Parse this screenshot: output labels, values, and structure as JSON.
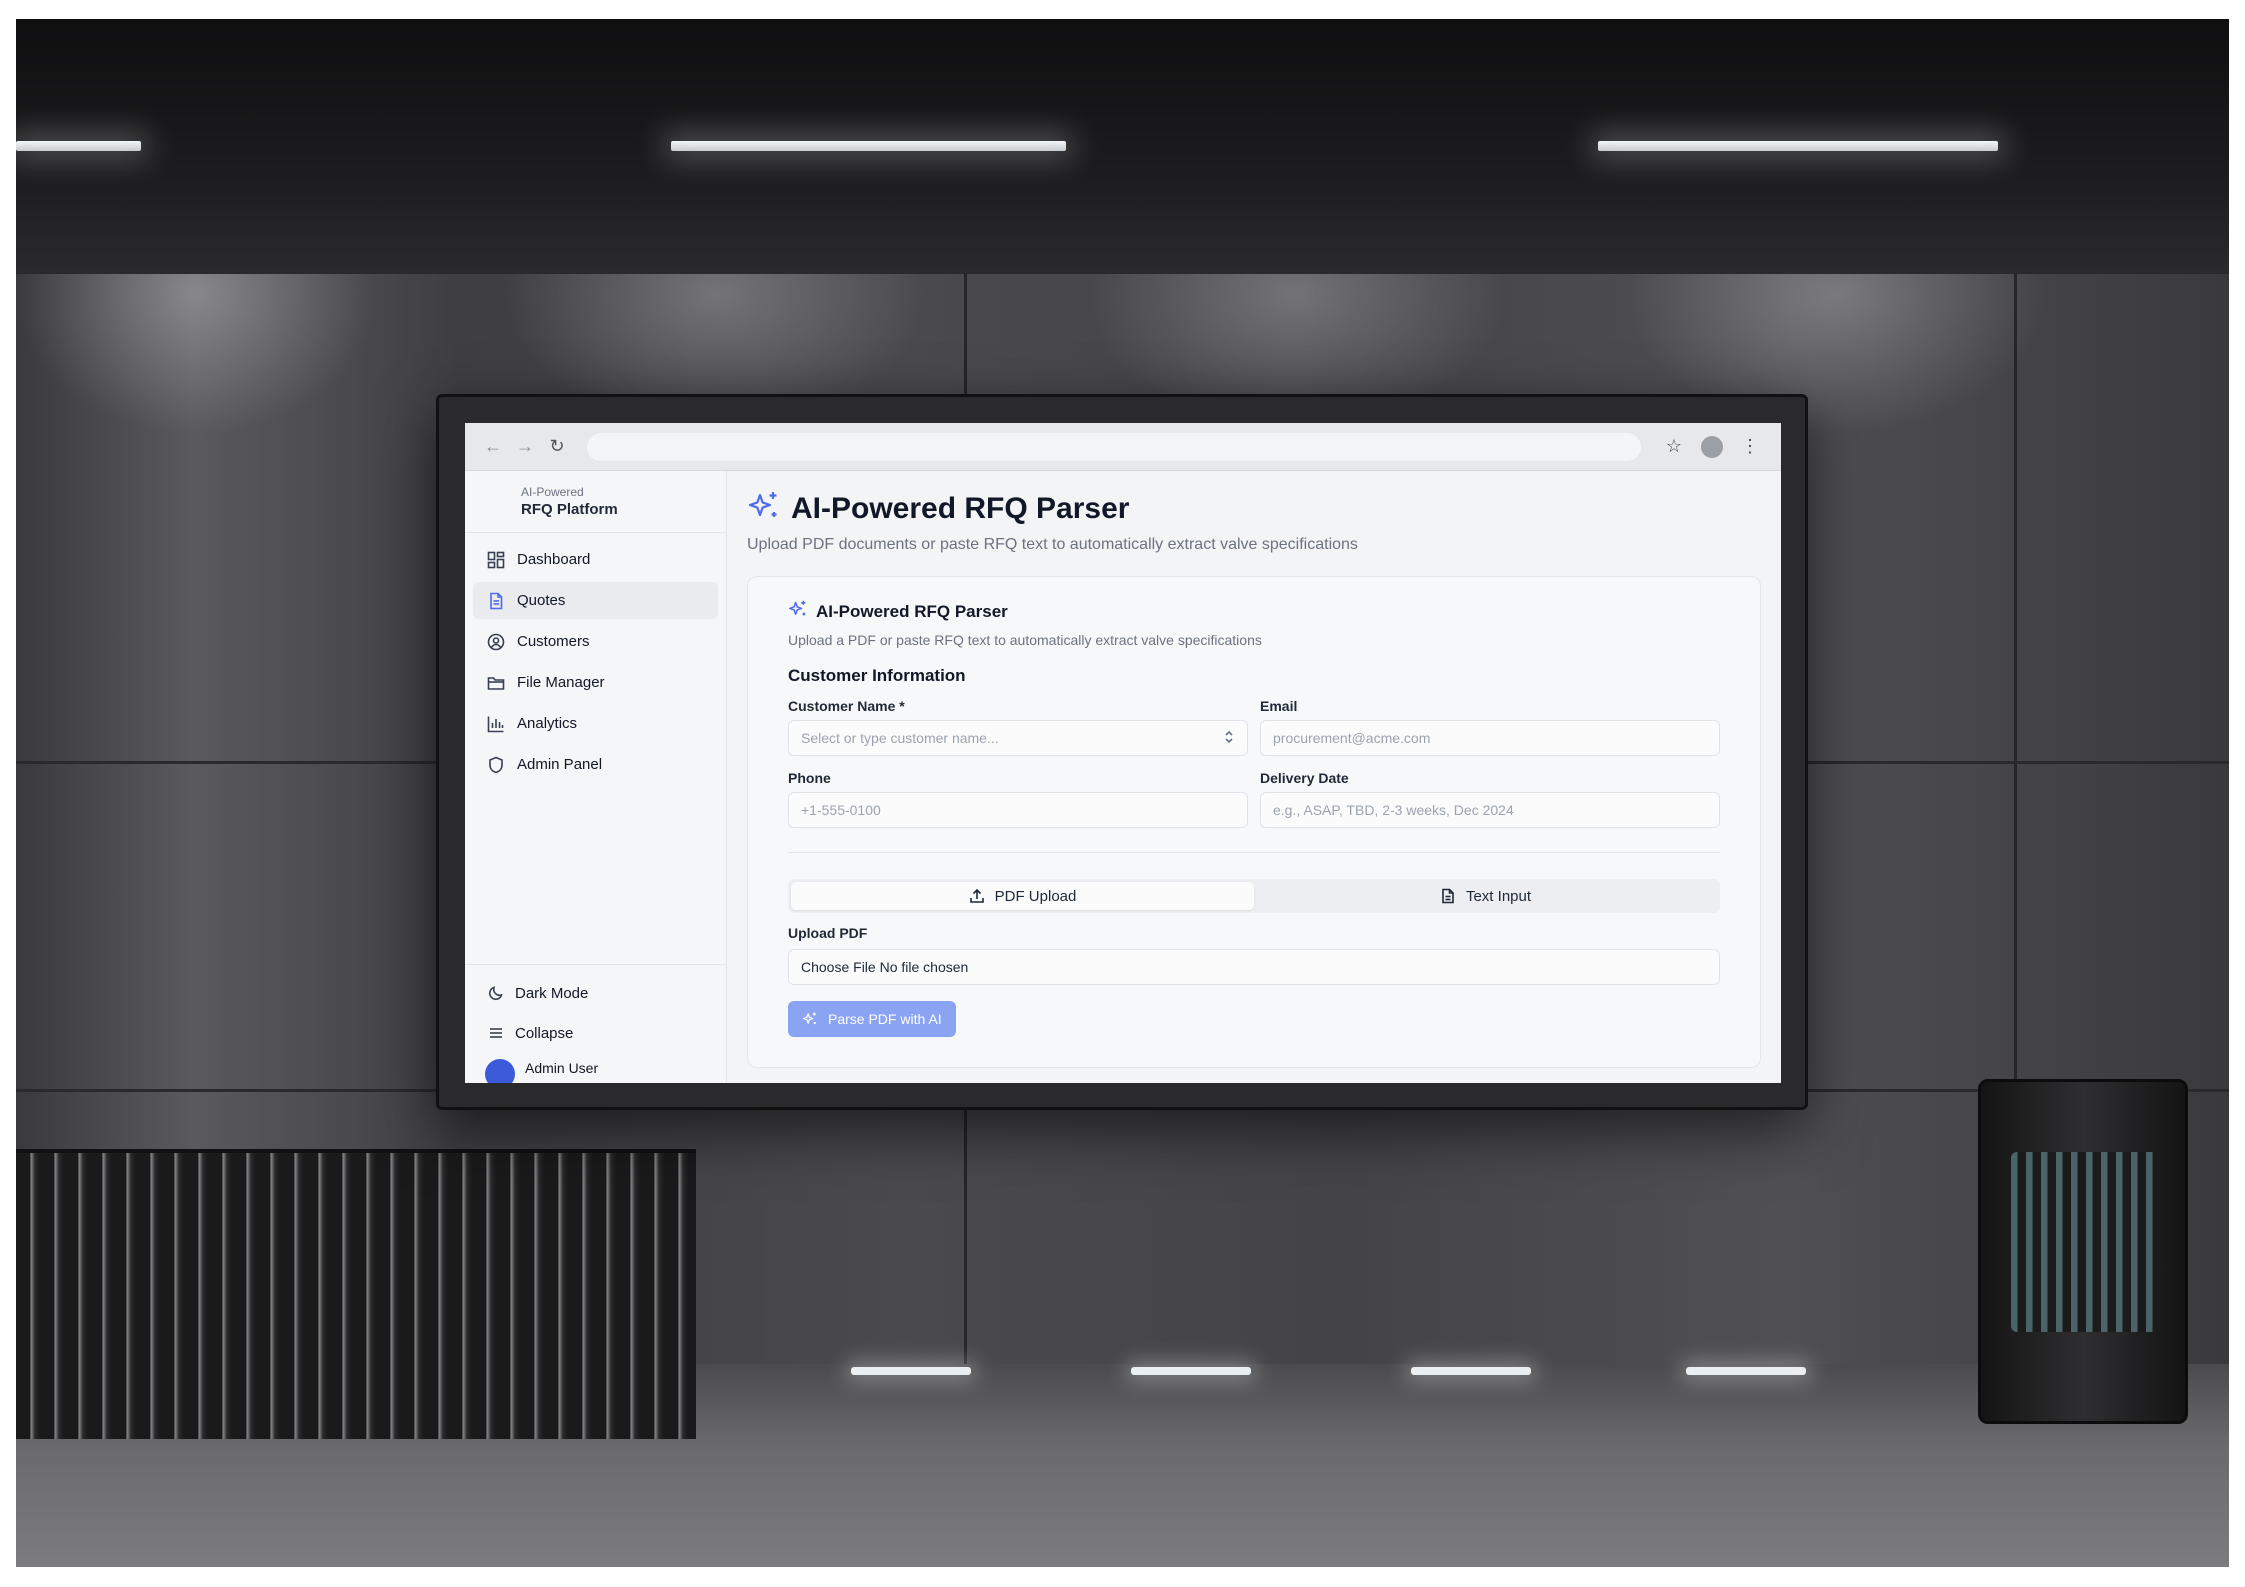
{
  "colors": {
    "accent": "#4f6bed",
    "parse_button": "#8aa4f3",
    "avatar": "#3b5bdb"
  },
  "browser": {
    "icons": [
      "back-arrow-icon",
      "forward-arrow-icon",
      "reload-icon",
      "star-icon",
      "profile-icon",
      "more-vert-icon"
    ]
  },
  "sidebar": {
    "brand_sub": "AI-Powered",
    "brand_title": "RFQ Platform",
    "items": [
      {
        "label": "Dashboard",
        "icon": "grid-icon"
      },
      {
        "label": "Quotes",
        "icon": "document-icon",
        "active": true
      },
      {
        "label": "Customers",
        "icon": "user-circle-icon"
      },
      {
        "label": "File Manager",
        "icon": "folder-icon"
      },
      {
        "label": "Analytics",
        "icon": "bar-chart-icon"
      },
      {
        "label": "Admin Panel",
        "icon": "shield-icon"
      }
    ],
    "dark_mode": "Dark Mode",
    "collapse": "Collapse",
    "user_name": "Admin User"
  },
  "main": {
    "title": "AI-Powered RFQ Parser",
    "subtitle": "Upload PDF documents or paste RFQ text to automatically extract valve specifications",
    "card": {
      "title": "AI-Powered RFQ Parser",
      "subtitle": "Upload a PDF or paste RFQ text to automatically extract valve specifications",
      "section_title": "Customer Information",
      "customer_name_label": "Customer Name *",
      "customer_name_placeholder": "Select or type customer name...",
      "email_label": "Email",
      "email_placeholder": "procurement@acme.com",
      "phone_label": "Phone",
      "phone_placeholder": "+1-555-0100",
      "delivery_label": "Delivery Date",
      "delivery_placeholder": "e.g., ASAP, TBD, 2-3 weeks, Dec 2024",
      "tabs": [
        {
          "label": "PDF Upload",
          "icon": "upload-icon",
          "active": true
        },
        {
          "label": "Text Input",
          "icon": "text-file-icon"
        }
      ],
      "upload_label": "Upload PDF",
      "file_input_text": "Choose File No file chosen",
      "parse_button": "Parse PDF with AI"
    }
  }
}
